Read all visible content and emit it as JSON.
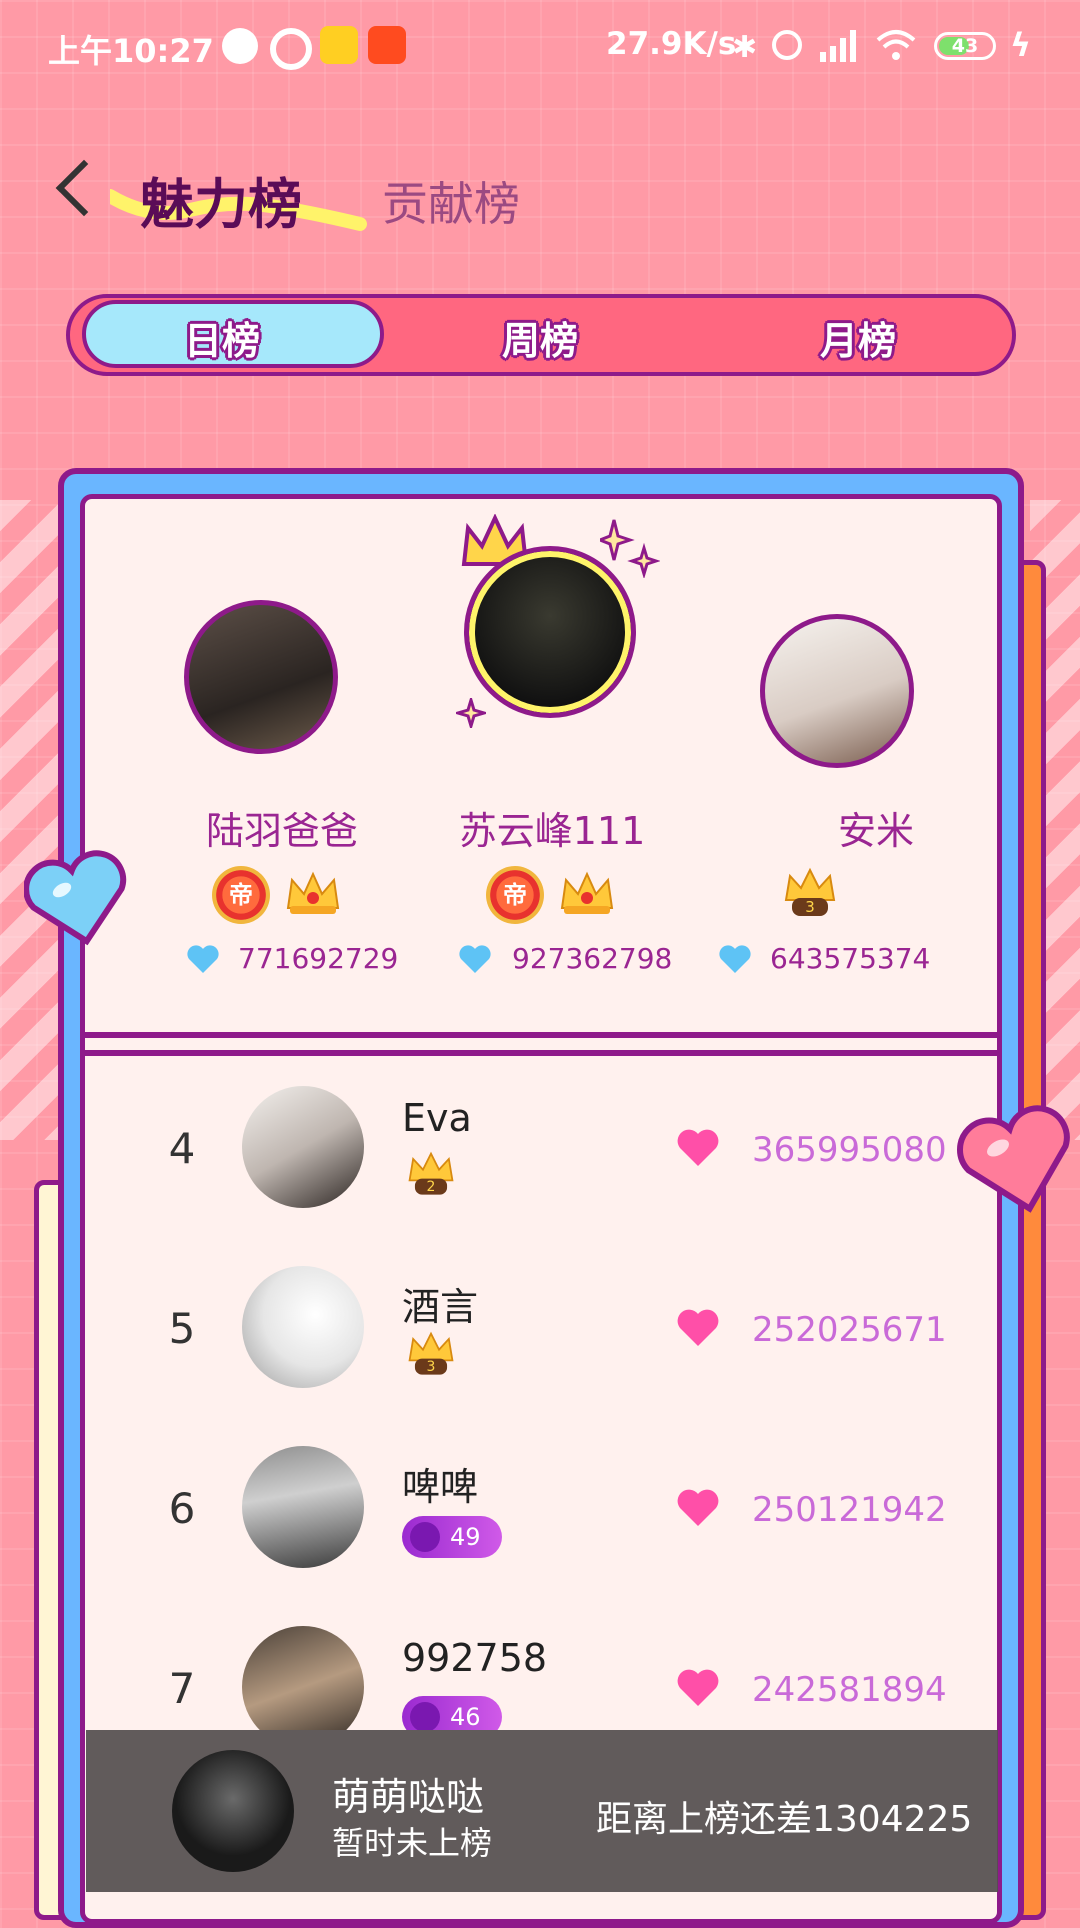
{
  "status_bar": {
    "time": "上午10:27",
    "speed": "27.9K/s",
    "battery": "43"
  },
  "header": {
    "active_tab": "魅力榜",
    "inactive_tab": "贡献榜"
  },
  "period_tabs": {
    "selected": "日榜",
    "items": [
      "日榜",
      "周榜",
      "月榜"
    ]
  },
  "podium": [
    {
      "rank": 2,
      "name": "陆羽爸爸",
      "score": "771692729",
      "crown_level": ""
    },
    {
      "rank": 1,
      "name": "苏云峰111",
      "score": "927362798",
      "crown_level": ""
    },
    {
      "rank": 3,
      "name": "安米",
      "score": "643575374",
      "crown_level": "3"
    }
  ],
  "badges": {
    "emperor": "帝"
  },
  "list": [
    {
      "rank": "4",
      "name": "Eva",
      "badge_type": "crown",
      "badge_value": "2",
      "score": "365995080"
    },
    {
      "rank": "5",
      "name": "酒言",
      "badge_type": "crown",
      "badge_value": "3",
      "score": "252025671"
    },
    {
      "rank": "6",
      "name": "啤啤",
      "badge_type": "level",
      "badge_value": "49",
      "score": "250121942"
    },
    {
      "rank": "7",
      "name": "992758",
      "badge_type": "level",
      "badge_value": "46",
      "score": "242581894"
    }
  ],
  "self": {
    "name": "萌萌哒哒",
    "status": "暂时未上榜",
    "gap_text": "距离上榜还差1304225"
  },
  "colors": {
    "background": "#ff9aa6",
    "accent_purple": "#8e1a8a",
    "tab_active": "#a6e8fb",
    "tab_bar": "#ff6780",
    "card_blue": "#6ab6ff",
    "score_pink": "#c96ad8",
    "heart_pink": "#ff4fa8",
    "heart_blue": "#5ec3f5"
  }
}
